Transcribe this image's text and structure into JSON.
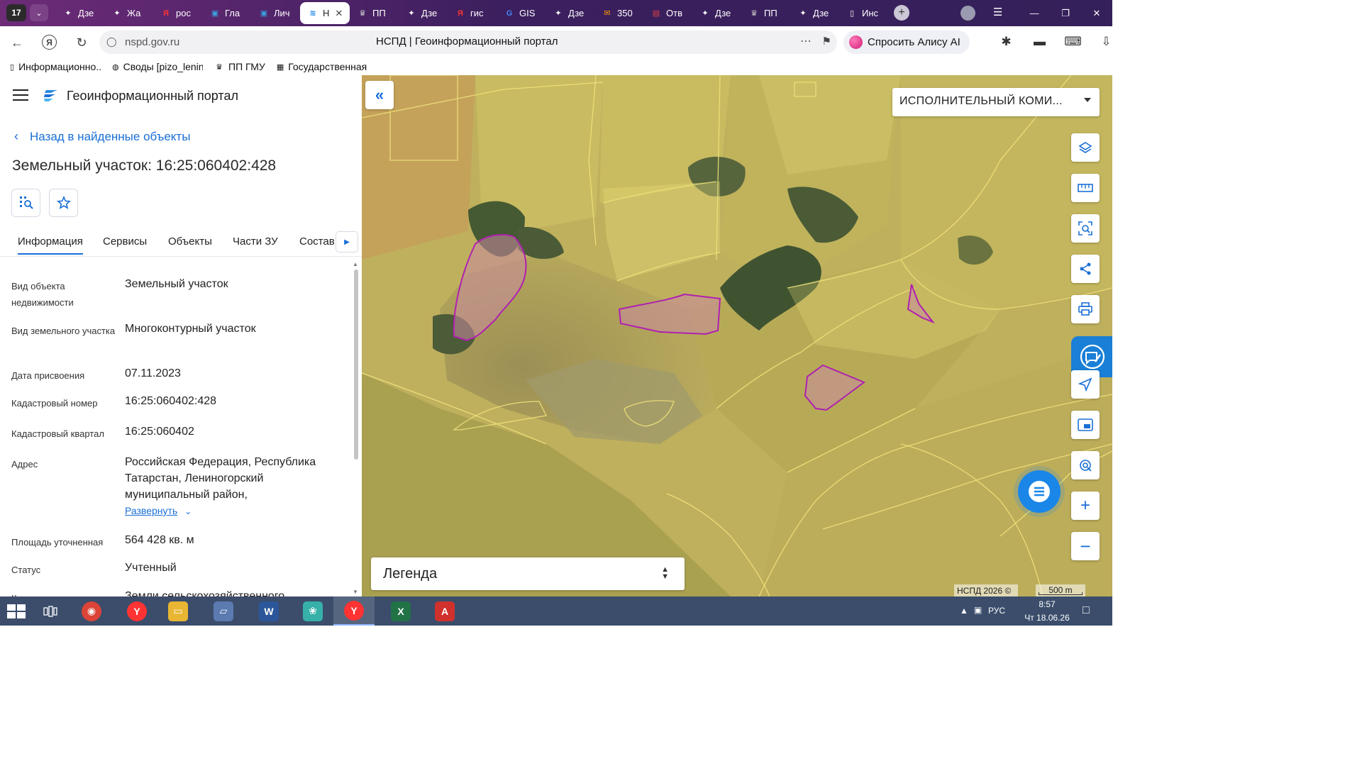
{
  "browser": {
    "tab_counter": "17",
    "tabs": [
      {
        "label": "Дзе",
        "icon": "sparkle-icon",
        "icon_color": "#ffffff"
      },
      {
        "label": "Жа",
        "icon": "sparkle-icon",
        "icon_color": "#ffffff"
      },
      {
        "label": "рос",
        "icon": "yandex-icon",
        "icon_color": "#f33"
      },
      {
        "label": "Гла",
        "icon": "gosuslugi-icon",
        "icon_color": "#3aa0e0"
      },
      {
        "label": "Лич",
        "icon": "gosuslugi-icon",
        "icon_color": "#3aa0e0"
      },
      {
        "label": "Н",
        "icon": "nspd-icon",
        "icon_color": "#1a86e8",
        "active": true
      },
      {
        "label": "ПП",
        "icon": "emblem-icon",
        "icon_color": "#cccccc"
      },
      {
        "label": "Дзе",
        "icon": "sparkle-icon",
        "icon_color": "#ffffff"
      },
      {
        "label": "гис",
        "icon": "yandex-icon",
        "icon_color": "#f33"
      },
      {
        "label": "GIS",
        "icon": "google-icon",
        "icon_color": "#4285f4"
      },
      {
        "label": "Дзе",
        "icon": "sparkle-icon",
        "icon_color": "#ffffff"
      },
      {
        "label": "350",
        "icon": "mail-icon",
        "icon_color": "#ff9900"
      },
      {
        "label": "Отв",
        "icon": "pdf-icon",
        "icon_color": "#e04040"
      },
      {
        "label": "Дзе",
        "icon": "sparkle-icon",
        "icon_color": "#ffffff"
      },
      {
        "label": "ПП",
        "icon": "emblem-icon",
        "icon_color": "#cccccc"
      },
      {
        "label": "Дзе",
        "icon": "sparkle-icon",
        "icon_color": "#ffffff"
      },
      {
        "label": "Инс",
        "icon": "doc-icon",
        "icon_color": "#ffffff"
      }
    ],
    "url": "nspd.gov.ru",
    "page_title": "НСПД | Геоинформационный портал",
    "alice_label": "Спросить Алису AI",
    "bookmarks": [
      {
        "label": "Информационно...",
        "icon": "doc-icon"
      },
      {
        "label": "Своды [pizo_lenin...",
        "icon": "globe-icon"
      },
      {
        "label": "ПП ГМУ",
        "icon": "emblem-icon"
      },
      {
        "label": "Государственная...",
        "icon": "gov-icon"
      }
    ]
  },
  "panel": {
    "portal_title": "Геоинформационный портал",
    "back_label": "Назад в найденные объекты",
    "object_title": "Земельный участок: 16:25:060402:428",
    "tabs": [
      "Информация",
      "Сервисы",
      "Объекты",
      "Части ЗУ",
      "Состав"
    ],
    "active_tab": "Информация",
    "properties": [
      {
        "label": "Вид объекта недвижимости",
        "value": "Земельный участок"
      },
      {
        "label": "Вид земельного участка",
        "value": "Многоконтурный участок"
      },
      {
        "label": "Дата присвоения",
        "value": "07.11.2023"
      },
      {
        "label": "Кадастровый номер",
        "value": "16:25:060402:428"
      },
      {
        "label": "Кадастровый квартал",
        "value": "16:25:060402"
      },
      {
        "label": "Адрес",
        "value": "Российская Федерация, Республика Татарстан, Лениногорский муниципальный район,"
      },
      {
        "label": "Площадь уточненная",
        "value": "564 428 кв. м"
      },
      {
        "label": "Статус",
        "value": "Учтенный"
      },
      {
        "label": "Категория земель",
        "value": "Земли сельскохозяйственного"
      }
    ],
    "expand_label": "Развернуть"
  },
  "map": {
    "layer_select": "ИСПОЛНИТЕЛЬНЫЙ КОМИ...",
    "legend_label": "Легенда",
    "copyright": "НСПД 2026 ©",
    "scale_label": "500 m",
    "tools": [
      "layers-icon",
      "ruler-icon",
      "select-area-icon",
      "share-icon",
      "print-icon",
      "feedback-icon",
      "navigate-icon",
      "picture-in-picture-icon",
      "geolocate-icon",
      "zoom-in-icon",
      "zoom-out-icon"
    ],
    "colors": {
      "parcel_outline": "#b020b0",
      "parcel_fill": "#c98aa0",
      "boundary": "#f2ea7a",
      "accent": "#1a86e8"
    }
  },
  "taskbar": {
    "apps": [
      "chrome-icon",
      "yandex-browser-icon",
      "file-explorer-icon",
      "scanner-icon",
      "word-icon",
      "paw-icon",
      "yandex-browser-icon",
      "excel-icon",
      "acrobat-icon"
    ],
    "language": "РУС",
    "time": "8:57",
    "date": "Чт 18.06.26"
  }
}
